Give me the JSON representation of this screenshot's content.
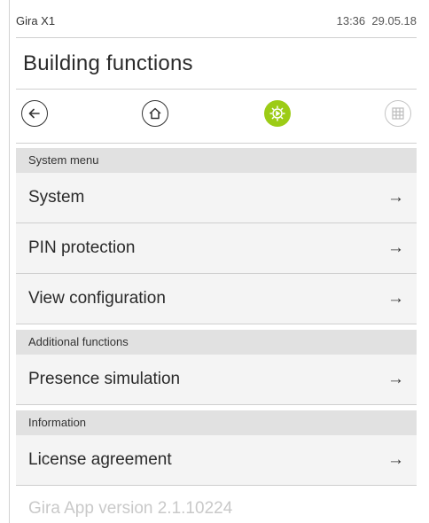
{
  "status_bar": {
    "device": "Gira X1",
    "time": "13:36",
    "date": "29.05.18"
  },
  "page": {
    "title": "Building functions"
  },
  "nav": {
    "back_icon": "arrow-left-circle-icon",
    "home_icon": "home-icon",
    "settings_icon": "gear-active-icon",
    "grid_icon": "grid-icon",
    "accent_color": "#9ccc16"
  },
  "sections": [
    {
      "header": "System menu",
      "items": [
        {
          "label": "System",
          "arrow": "→"
        },
        {
          "label": "PIN protection",
          "arrow": "→"
        },
        {
          "label": "View configuration",
          "arrow": "→"
        }
      ]
    },
    {
      "header": "Additional functions",
      "items": [
        {
          "label": "Presence simulation",
          "arrow": "→"
        }
      ]
    },
    {
      "header": "Information",
      "items": [
        {
          "label": "License agreement",
          "arrow": "→"
        }
      ]
    }
  ],
  "footer": {
    "version_text": "Gira App version 2.1.10224"
  }
}
